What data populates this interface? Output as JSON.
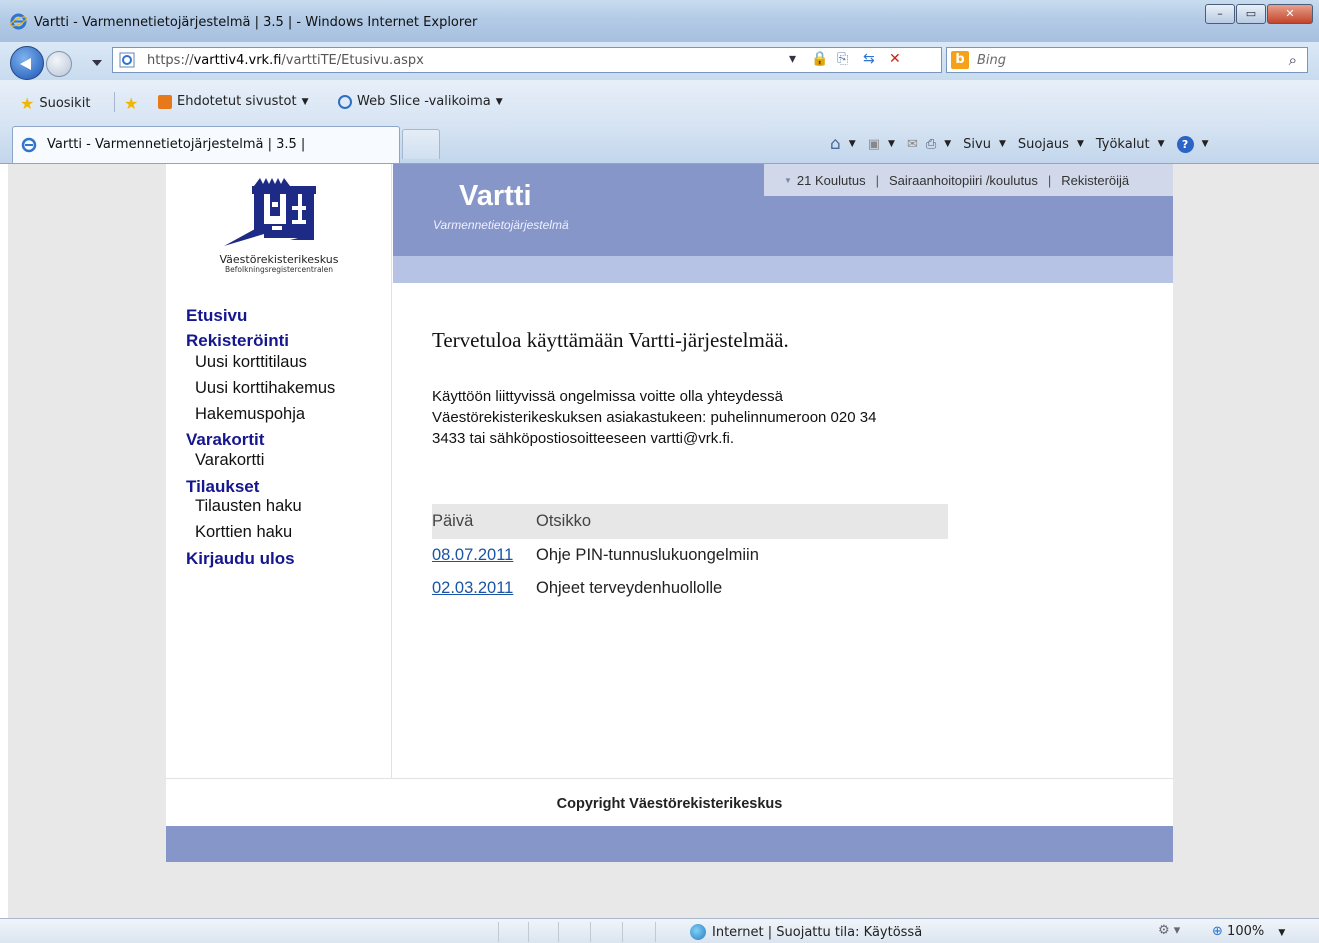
{
  "browser": {
    "window_title": "Vartti - Varmennetietojärjestelmä | 3.5 | - Windows Internet Explorer",
    "window_buttons": {
      "minimize": "–",
      "maximize": "▭",
      "close": "✕"
    },
    "url_scheme": "https://",
    "url_host": "varttiv4.vrk.fi",
    "url_path": "/varttiTE/Etusivu.aspx",
    "search_placeholder": "Bing",
    "favorites_label": "Suosikit",
    "suggested_sites": "Ehdotetut sivustot",
    "web_slice": "Web Slice -valikoima",
    "tab_title": "Vartti - Varmennetietojärjestelmä | 3.5 |",
    "commands": {
      "page": "Sivu",
      "safety": "Suojaus",
      "tools": "Työkalut"
    },
    "status_zone": "Internet | Suojattu tila: Käytössä",
    "zoom": "100%"
  },
  "logo": {
    "name": "Väestörekisterikeskus",
    "sub": "Befolkningsregistercentralen"
  },
  "banner": {
    "brand": "Vartti",
    "tagline": "Varmennetietojärjestelmä",
    "toplinks": [
      "21 Koulutus",
      "Sairaanhoitopiiri /koulutus",
      "Rekisteröijä"
    ]
  },
  "nav": {
    "home": "Etusivu",
    "registration": "Rekisteröinti",
    "new_card_order": "Uusi korttitilaus",
    "new_card_application": "Uusi korttihakemus",
    "application_template": "Hakemuspohja",
    "spare_cards": "Varakortit",
    "spare_card": "Varakortti",
    "orders": "Tilaukset",
    "order_search": "Tilausten haku",
    "card_search": "Korttien haku",
    "logout": "Kirjaudu ulos"
  },
  "content": {
    "welcome": "Tervetuloa käyttämään Vartti-järjestelmää.",
    "info_line1": "Käyttöön liittyvissä ongelmissa voitte olla yhteydessä",
    "info_line2": "Väestörekisterikeskuksen asiakastukeen: puhelinnumeroon 020 34",
    "info_line3": "3433 tai sähköpostiosoitteeseen vartti@vrk.fi.",
    "table_headers": {
      "date": "Päivä",
      "title": "Otsikko"
    },
    "news": [
      {
        "date": "08.07.2011",
        "title": "Ohje PIN-tunnuslukuongelmiin"
      },
      {
        "date": "02.03.2011",
        "title": "Ohjeet terveydenhuollolle"
      }
    ]
  },
  "footer": {
    "copyright": "Copyright Väestörekisterikeskus"
  },
  "colors": {
    "banner": "#8796c8",
    "band": "#b6c3e4",
    "nav_heading": "#16178f",
    "link": "#1b54a5"
  }
}
